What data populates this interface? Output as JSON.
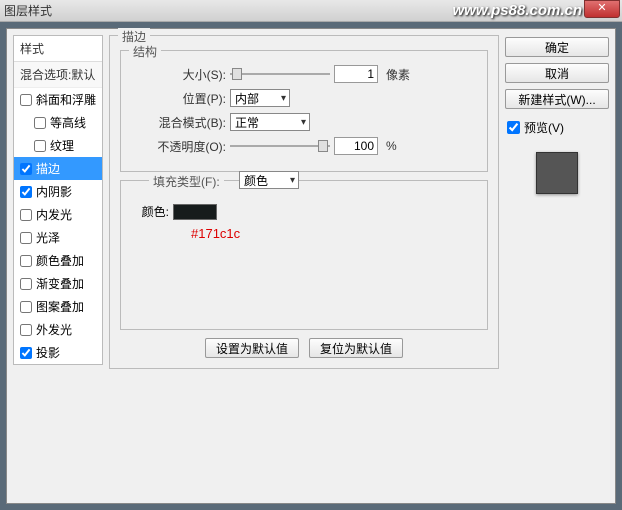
{
  "window": {
    "title": "图层样式"
  },
  "watermark": "www.ps88.com.cn",
  "left": {
    "header": "样式",
    "blend": "混合选项:默认",
    "items": [
      {
        "label": "斜面和浮雕",
        "checked": false,
        "indent": false
      },
      {
        "label": "等高线",
        "checked": false,
        "indent": true
      },
      {
        "label": "纹理",
        "checked": false,
        "indent": true
      },
      {
        "label": "描边",
        "checked": true,
        "indent": false,
        "selected": true
      },
      {
        "label": "内阴影",
        "checked": true,
        "indent": false
      },
      {
        "label": "内发光",
        "checked": false,
        "indent": false
      },
      {
        "label": "光泽",
        "checked": false,
        "indent": false
      },
      {
        "label": "颜色叠加",
        "checked": false,
        "indent": false
      },
      {
        "label": "渐变叠加",
        "checked": false,
        "indent": false
      },
      {
        "label": "图案叠加",
        "checked": false,
        "indent": false
      },
      {
        "label": "外发光",
        "checked": false,
        "indent": false
      },
      {
        "label": "投影",
        "checked": true,
        "indent": false
      }
    ]
  },
  "mid": {
    "panel_title": "描边",
    "structure_title": "结构",
    "size_label": "大小(S):",
    "size_value": "1",
    "size_unit": "像素",
    "position_label": "位置(P):",
    "position_value": "内部",
    "blendmode_label": "混合模式(B):",
    "blendmode_value": "正常",
    "opacity_label": "不透明度(O):",
    "opacity_value": "100",
    "opacity_unit": "%",
    "filltype_label": "填充类型(F):",
    "filltype_value": "颜色",
    "color_label": "颜色:",
    "annotation": "#171c1c",
    "set_default": "设置为默认值",
    "reset_default": "复位为默认值"
  },
  "right": {
    "ok": "确定",
    "cancel": "取消",
    "new_style": "新建样式(W)...",
    "preview": "预览(V)"
  },
  "colors": {
    "swatch": "#171c1c"
  }
}
